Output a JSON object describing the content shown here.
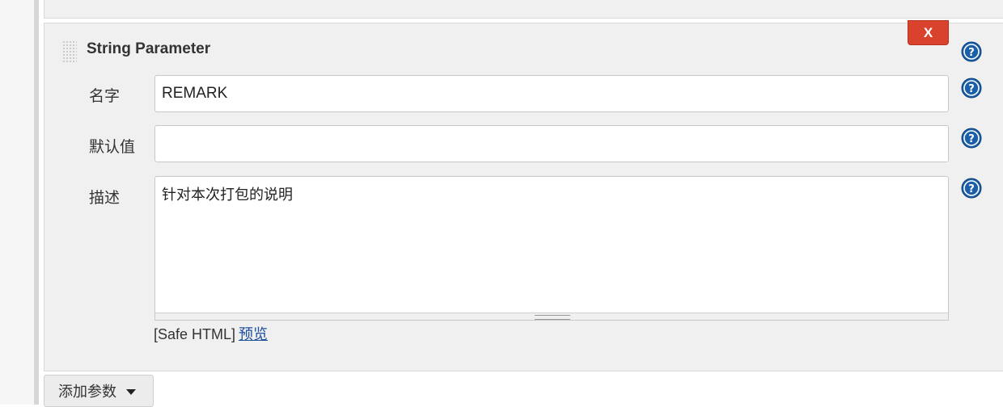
{
  "param": {
    "title": "String Parameter",
    "delete_label": "X"
  },
  "fields": {
    "name": {
      "label": "名字",
      "value": "REMARK"
    },
    "default": {
      "label": "默认值",
      "value": ""
    },
    "description": {
      "label": "描述",
      "value": "针对本次打包的说明"
    }
  },
  "safe_html": {
    "prefix": "[Safe HTML]",
    "preview_label": "预览"
  },
  "add_param": {
    "label": "添加参数"
  },
  "colors": {
    "delete_button": "#d9422c",
    "help_icon": "#1a5fa8",
    "link": "#1c4f9c"
  },
  "icons": [
    "drag-handle-icon",
    "help-icon",
    "caret-down-icon"
  ]
}
